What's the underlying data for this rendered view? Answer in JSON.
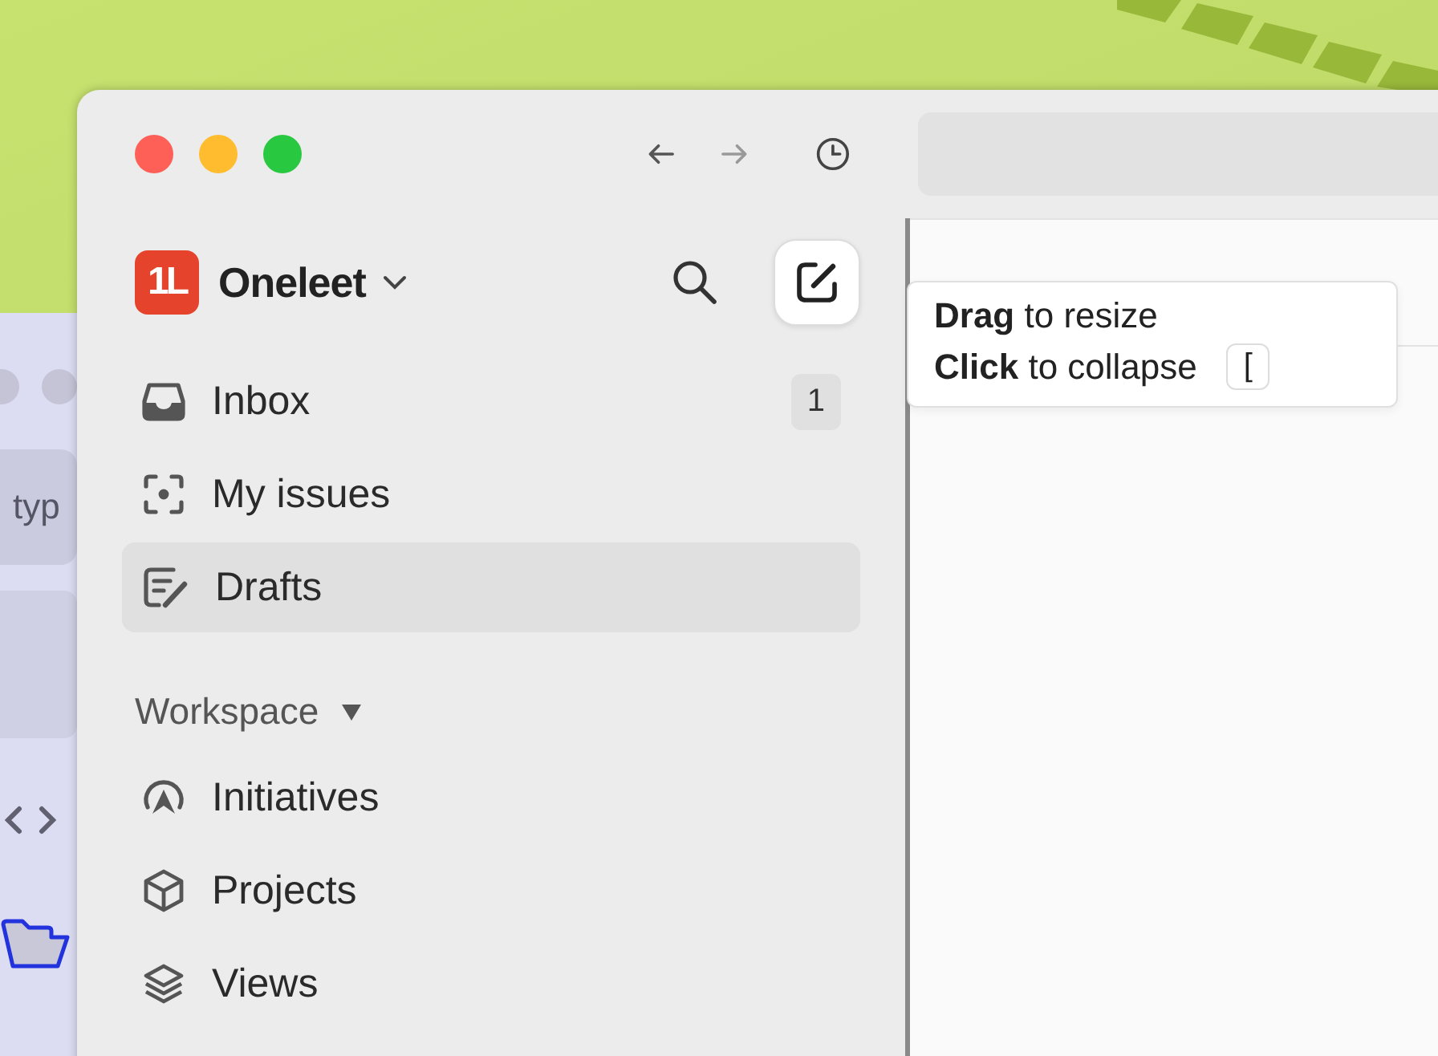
{
  "background_window": {
    "text": "typ"
  },
  "workspace": {
    "logo": "1L",
    "name": "Oneleet"
  },
  "nav": [
    {
      "label": "Inbox",
      "kind": "inbox",
      "badge": "1",
      "selected": false
    },
    {
      "label": "My issues",
      "kind": "focus",
      "selected": false
    },
    {
      "label": "Drafts",
      "kind": "draft",
      "selected": true
    }
  ],
  "section": {
    "label": "Workspace",
    "expanded": true,
    "items": [
      {
        "label": "Initiatives",
        "kind": "initiative",
        "selected": false
      },
      {
        "label": "Projects",
        "kind": "cube",
        "selected": false
      },
      {
        "label": "Views",
        "kind": "layers",
        "selected": false
      }
    ]
  },
  "tooltip": {
    "lines": [
      {
        "text": "**Drag** to resize"
      },
      {
        "text": "**Click** to collapse",
        "shortcut": "["
      }
    ]
  }
}
